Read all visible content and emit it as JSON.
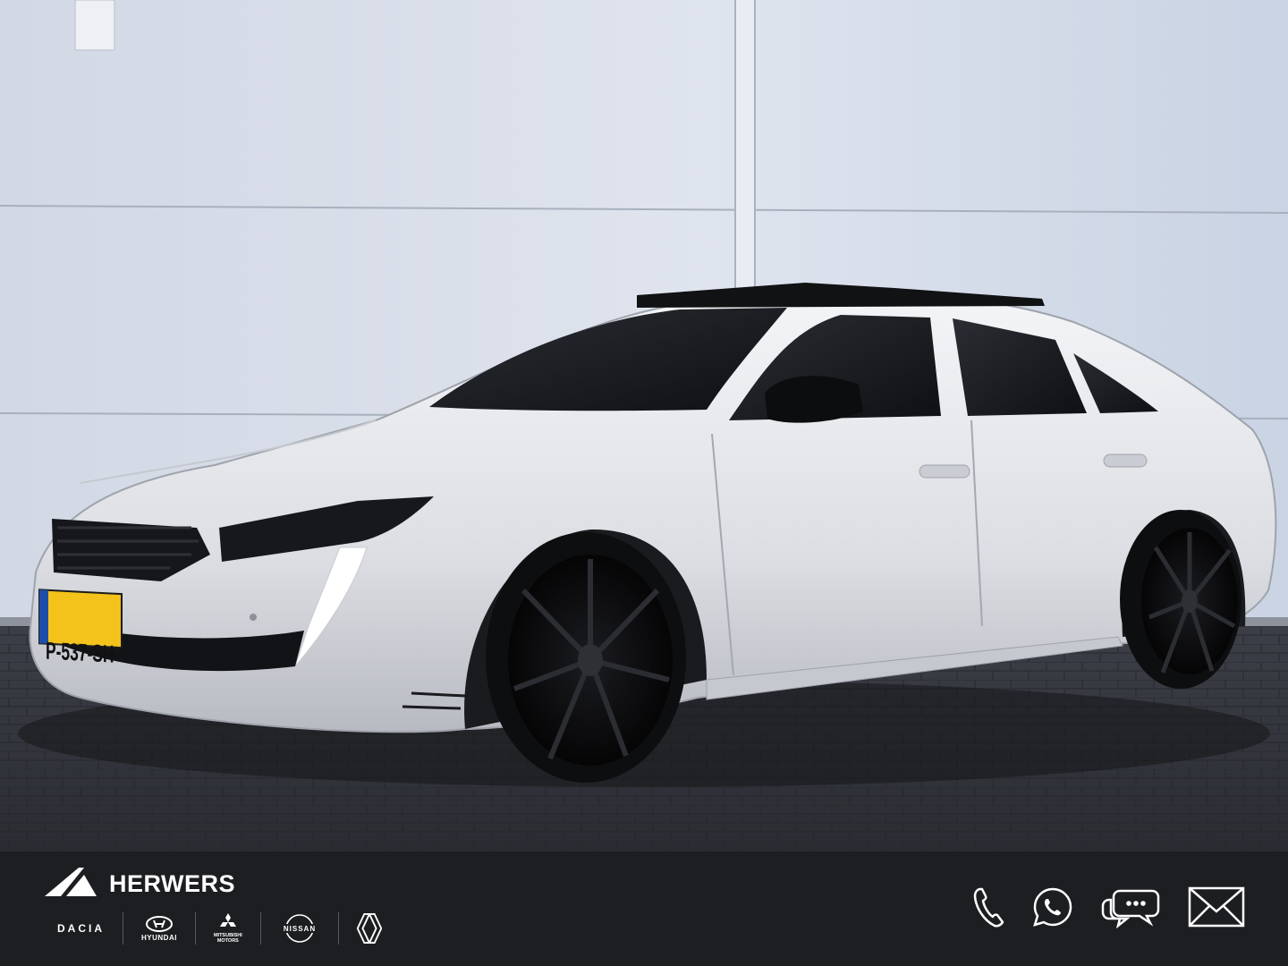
{
  "photo": {
    "license_plate": "P-537-SH"
  },
  "dealer": {
    "name": "HERWERS",
    "logo_icon": "herwers-triangle-logo"
  },
  "partners": [
    {
      "label": "DACIA",
      "icon": "dacia-logo"
    },
    {
      "label": "HYUNDAI",
      "icon": "hyundai-logo"
    },
    {
      "label": "MITSUBISHI\nMOTORS",
      "icon": "mitsubishi-logo"
    },
    {
      "label": "NISSAN",
      "icon": "nissan-logo"
    },
    {
      "label": "",
      "icon": "renault-logo"
    }
  ],
  "contacts": [
    {
      "icon": "phone-icon"
    },
    {
      "icon": "whatsapp-icon"
    },
    {
      "icon": "chat-icon"
    },
    {
      "icon": "mail-icon"
    }
  ],
  "colors": {
    "footer_bg": "#1d1e22",
    "text": "#ffffff",
    "plate": "#f3c21b"
  }
}
